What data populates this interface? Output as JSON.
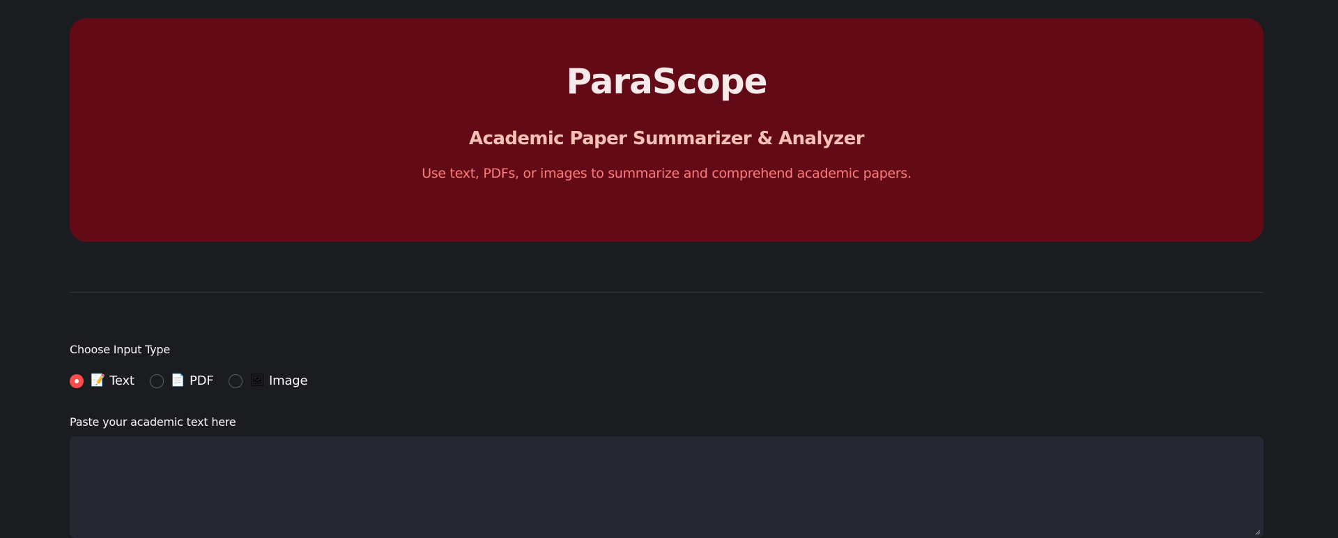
{
  "hero": {
    "title": "ParaScope",
    "subtitle": "Academic Paper Summarizer & Analyzer",
    "description": "Use text, PDFs, or images to summarize and comprehend academic papers."
  },
  "input_type": {
    "label": "Choose Input Type",
    "options": [
      {
        "emoji": "📝",
        "label": "Text",
        "selected": true
      },
      {
        "emoji": "📄",
        "label": "PDF",
        "selected": false
      },
      {
        "emoji": "🖼",
        "label": "Image",
        "selected": false
      }
    ]
  },
  "text_input": {
    "label": "Paste your academic text here",
    "value": "",
    "placeholder": ""
  },
  "colors": {
    "background": "#1b1c20",
    "hero_background": "#620b17",
    "accent": "#ff4b4b",
    "textarea_background": "#262730"
  }
}
